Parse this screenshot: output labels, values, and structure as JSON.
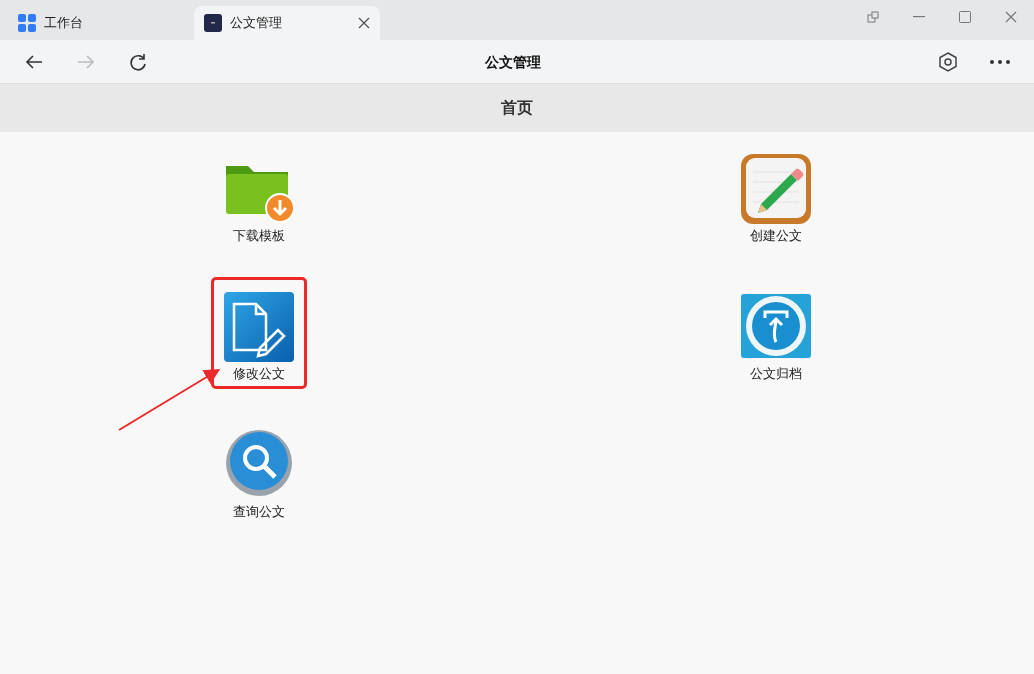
{
  "tabs": [
    {
      "label": "工作台",
      "selected": false,
      "kind": "grid"
    },
    {
      "label": "公文管理",
      "selected": true,
      "kind": "app"
    }
  ],
  "toolbar": {
    "title": "公文管理"
  },
  "page": {
    "title": "首页"
  },
  "items": [
    {
      "label": "下载模板",
      "kind": "download",
      "highlighted": false
    },
    {
      "label": "创建公文",
      "kind": "create",
      "highlighted": false
    },
    {
      "label": "修改公文",
      "kind": "edit",
      "highlighted": true
    },
    {
      "label": "公文归档",
      "kind": "archive",
      "highlighted": false
    },
    {
      "label": "查询公文",
      "kind": "search",
      "highlighted": false
    }
  ]
}
